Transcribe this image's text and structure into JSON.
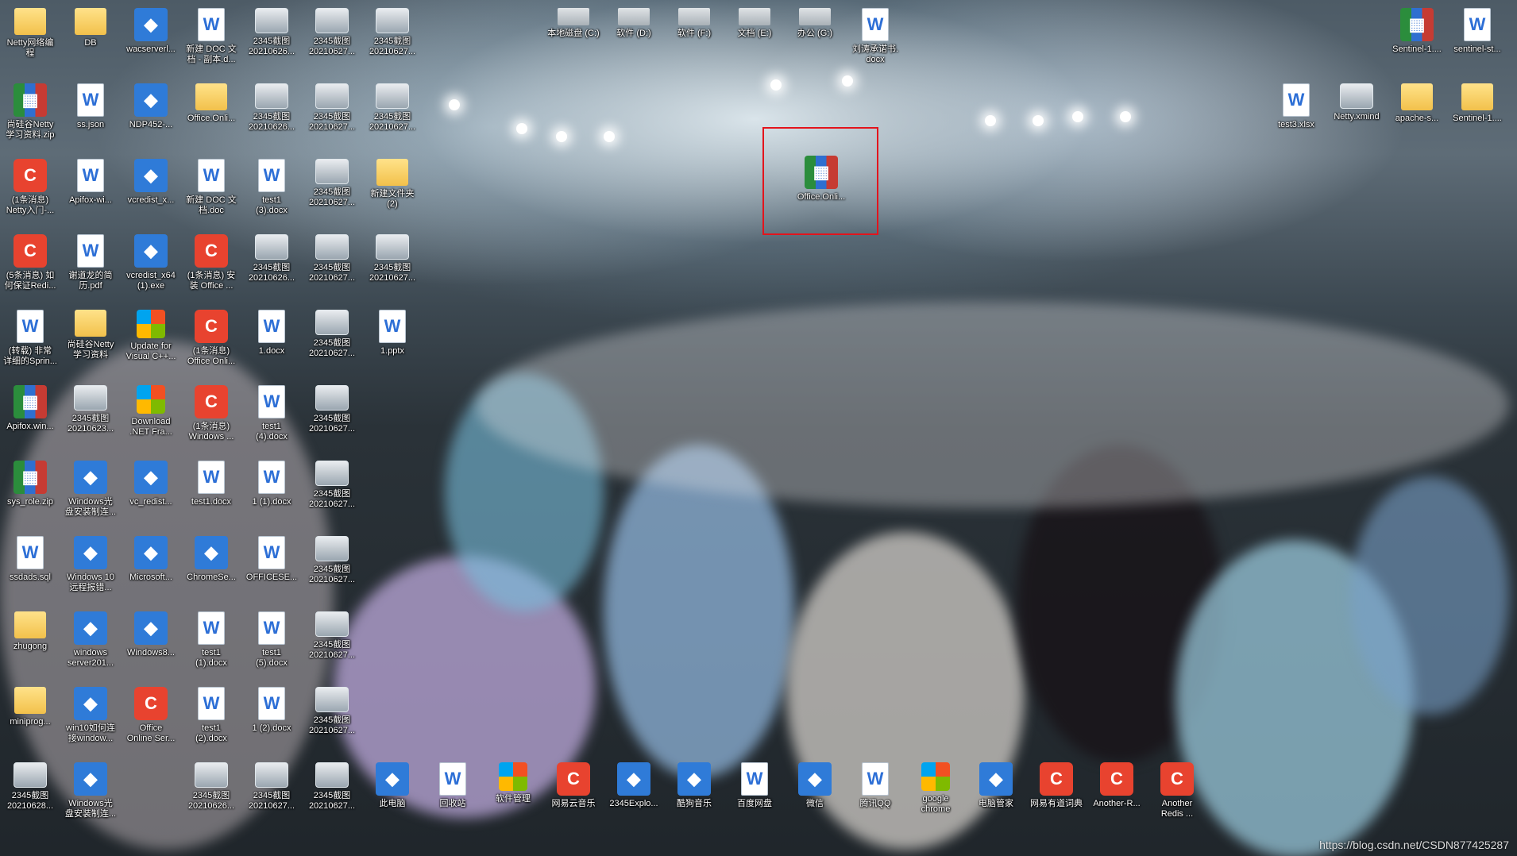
{
  "desktop": {
    "watermark": "https://blog.csdn.net/CSDN877425287",
    "selected_icon": "Office.Onli...",
    "icons_col1": [
      {
        "label": "Netty网络编\n程",
        "icon": "folder"
      },
      {
        "label": "尚硅谷Netty\n学习资料.zip",
        "icon": "rar"
      },
      {
        "label": "(1条消息)\nNetty入门-...",
        "icon": "redc"
      },
      {
        "label": "(5条消息) 如\n何保证Redi...",
        "icon": "redc"
      },
      {
        "label": "(转载) 非常\n详细的Sprin...",
        "icon": "doc"
      },
      {
        "label": "Apifox.win...",
        "icon": "rar"
      },
      {
        "label": "sys_role.zip",
        "icon": "rar"
      },
      {
        "label": "ssdads.sql",
        "icon": "doc"
      },
      {
        "label": "zhugong",
        "icon": "folder"
      },
      {
        "label": "miniprog...",
        "icon": "folder"
      },
      {
        "label": "2345截图\n20210628...",
        "icon": "img"
      }
    ],
    "icons_col2": [
      {
        "label": "DB",
        "icon": "folder"
      },
      {
        "label": "ss.json",
        "icon": "doc"
      },
      {
        "label": "Apifox-wi...",
        "icon": "doc"
      },
      {
        "label": "谢道龙的简\n历.pdf",
        "icon": "doc"
      },
      {
        "label": "尚硅谷Netty\n学习资料",
        "icon": "folder"
      },
      {
        "label": "2345截图\n20210623...",
        "icon": "img"
      },
      {
        "label": "Windows光\n盘安装制连...",
        "icon": "blue"
      },
      {
        "label": "Windows 10\n远程报错...",
        "icon": "blue"
      },
      {
        "label": "windows\nserver201...",
        "icon": "blue"
      },
      {
        "label": "win10如何连\n接window...",
        "icon": "blue"
      },
      {
        "label": "Windows光\n盘安装制连...",
        "icon": "blue"
      }
    ],
    "icons_col3": [
      {
        "label": "wacserverl...",
        "icon": "blue"
      },
      {
        "label": "NDP452-...",
        "icon": "blue"
      },
      {
        "label": "vcredist_x...",
        "icon": "blue"
      },
      {
        "label": "vcredist_x64\n(1).exe",
        "icon": "blue"
      },
      {
        "label": "Update for\nVisual C++...",
        "icon": "ms"
      },
      {
        "label": "Download\n.NET Fra...",
        "icon": "ms"
      },
      {
        "label": "vc_redist...",
        "icon": "blue"
      },
      {
        "label": "Microsoft...",
        "icon": "blue"
      },
      {
        "label": "Windows8...",
        "icon": "blue"
      },
      {
        "label": "Office\nOnline Ser...",
        "icon": "redc"
      }
    ],
    "icons_col4": [
      {
        "label": "新建 DOC 文\n档 - 副本.d...",
        "icon": "doc"
      },
      {
        "label": "Office.Onli...",
        "icon": "folder"
      },
      {
        "label": "新建 DOC 文\n档.doc",
        "icon": "doc"
      },
      {
        "label": "(1条消息) 安\n装 Office ...",
        "icon": "redc"
      },
      {
        "label": "(1条消息)\nOffice Onli...",
        "icon": "redc"
      },
      {
        "label": "(1条消息)\nWindows ...",
        "icon": "redc"
      },
      {
        "label": "test1.docx",
        "icon": "doc"
      },
      {
        "label": "ChromeSe...",
        "icon": "blue"
      },
      {
        "label": "test1\n(1).docx",
        "icon": "doc"
      },
      {
        "label": "test1\n(2).docx",
        "icon": "doc"
      },
      {
        "label": "2345截图\n20210626...",
        "icon": "img"
      }
    ],
    "icons_col5": [
      {
        "label": "2345截图\n20210626...",
        "icon": "img"
      },
      {
        "label": "2345截图\n20210626...",
        "icon": "img"
      },
      {
        "label": "test1\n(3).docx",
        "icon": "doc"
      },
      {
        "label": "2345截图\n20210626...",
        "icon": "img"
      },
      {
        "label": "1.docx",
        "icon": "doc"
      },
      {
        "label": "test1\n(4).docx",
        "icon": "doc"
      },
      {
        "label": "1 (1).docx",
        "icon": "doc"
      },
      {
        "label": "OFFICESE...",
        "icon": "doc"
      },
      {
        "label": "test1\n(5).docx",
        "icon": "doc"
      },
      {
        "label": "1 (2).docx",
        "icon": "doc"
      },
      {
        "label": "2345截图\n20210627...",
        "icon": "img"
      }
    ],
    "icons_col6": [
      {
        "label": "2345截图\n20210627...",
        "icon": "img"
      },
      {
        "label": "2345截图\n20210627...",
        "icon": "img"
      },
      {
        "label": "2345截图\n20210627...",
        "icon": "img"
      },
      {
        "label": "2345截图\n20210627...",
        "icon": "img"
      },
      {
        "label": "2345截图\n20210627...",
        "icon": "img"
      },
      {
        "label": "2345截图\n20210627...",
        "icon": "img"
      },
      {
        "label": "2345截图\n20210627...",
        "icon": "img"
      },
      {
        "label": "2345截图\n20210627...",
        "icon": "img"
      },
      {
        "label": "2345截图\n20210627...",
        "icon": "img"
      },
      {
        "label": "2345截图\n20210627...",
        "icon": "img"
      },
      {
        "label": "2345截图\n20210627...",
        "icon": "img"
      }
    ],
    "icons_col7": [
      {
        "label": "2345截图\n20210627...",
        "icon": "img"
      },
      {
        "label": "2345截图\n20210627...",
        "icon": "img"
      },
      {
        "label": "新建文件夹\n(2)",
        "icon": "folder"
      },
      {
        "label": "2345截图\n20210627...",
        "icon": "img"
      },
      {
        "label": "1.pptx",
        "icon": "doc"
      }
    ],
    "drives": [
      {
        "label": "本地磁盘 (C:)"
      },
      {
        "label": "软件 (D:)"
      },
      {
        "label": "软件 (F:)"
      },
      {
        "label": "文档 (E:)"
      },
      {
        "label": "办公 (G:)"
      },
      {
        "label": "刘涛承诺书.\ndocx"
      }
    ],
    "right_top": [
      {
        "label": "Sentinel-1....",
        "icon": "rar"
      },
      {
        "label": "sentinel-st...",
        "icon": "doc"
      }
    ],
    "right_row2": [
      {
        "label": "test3.xlsx",
        "icon": "doc"
      },
      {
        "label": "Netty.xmind",
        "icon": "img"
      },
      {
        "label": "apache-s...",
        "icon": "folder"
      },
      {
        "label": "Sentinel-1....",
        "icon": "folder"
      }
    ],
    "bottom_row": [
      {
        "label": "此电脑",
        "icon": "blue"
      },
      {
        "label": "回收站",
        "icon": "doc"
      },
      {
        "label": "软件管理",
        "icon": "ms"
      },
      {
        "label": "网易云音乐",
        "icon": "redc"
      },
      {
        "label": "2345Explo...",
        "icon": "blue"
      },
      {
        "label": "酷狗音乐",
        "icon": "blue"
      },
      {
        "label": "百度网盘",
        "icon": "doc"
      },
      {
        "label": "微信",
        "icon": "blue"
      },
      {
        "label": "腾讯QQ",
        "icon": "doc"
      },
      {
        "label": "google\nchrome",
        "icon": "ms"
      },
      {
        "label": "电脑管家",
        "icon": "blue"
      },
      {
        "label": "网易有道词典",
        "icon": "redc"
      },
      {
        "label": "Another-R...",
        "icon": "redc"
      },
      {
        "label": "Another\nRedis ...",
        "icon": "redc"
      }
    ]
  }
}
